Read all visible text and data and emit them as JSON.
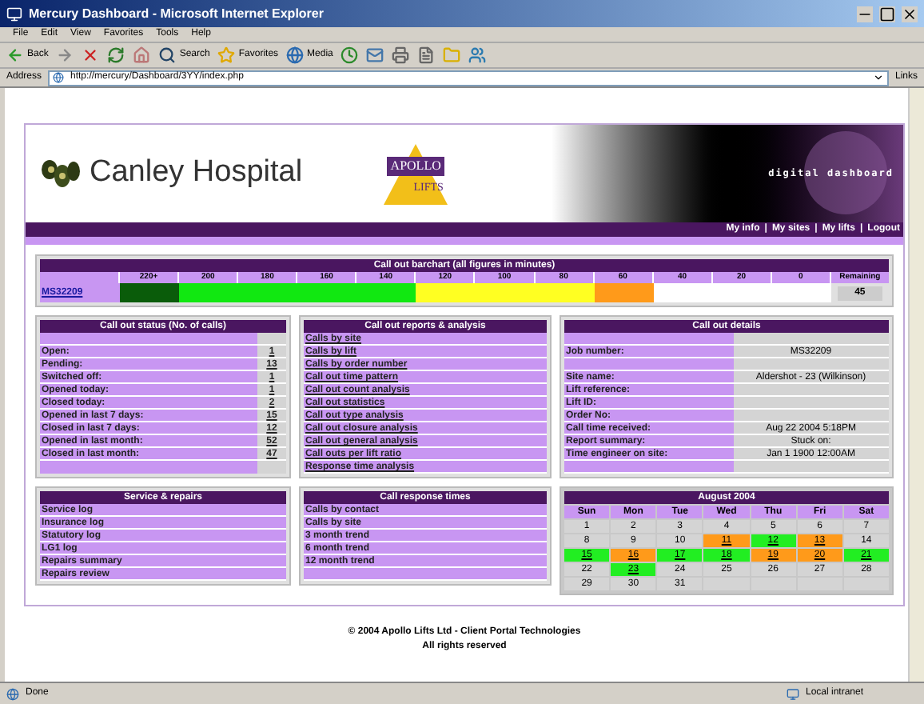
{
  "window": {
    "title": "Mercury Dashboard - Microsoft Internet Explorer"
  },
  "menu": [
    "File",
    "Edit",
    "View",
    "Favorites",
    "Tools",
    "Help"
  ],
  "toolbar": [
    {
      "kind": "back",
      "label": "Back"
    },
    {
      "kind": "forward"
    },
    {
      "kind": "stop"
    },
    {
      "kind": "refresh"
    },
    {
      "kind": "home"
    },
    {
      "kind": "search",
      "label": "Search"
    },
    {
      "kind": "favorites",
      "label": "Favorites"
    },
    {
      "kind": "media",
      "label": "Media"
    },
    {
      "kind": "history"
    },
    {
      "kind": "mail"
    },
    {
      "kind": "print"
    },
    {
      "kind": "edit"
    },
    {
      "kind": "folder"
    },
    {
      "kind": "messenger"
    }
  ],
  "address": {
    "label": "Address",
    "url": "http://mercury/Dashboard/3YY/index.php",
    "links": "Links"
  },
  "header": {
    "site": "Canley Hospital",
    "brand_top": "APOLLO",
    "brand_bottom": "LIFTS",
    "tagline": "digital dashboard",
    "nav": [
      "My info",
      "My sites",
      "My lifts",
      "Logout"
    ],
    "nav_separator": "|"
  },
  "barchart": {
    "title": "Call out barchart (all figures in minutes)",
    "columns": [
      "220+",
      "200",
      "180",
      "160",
      "140",
      "120",
      "100",
      "80",
      "60",
      "40",
      "20",
      "0"
    ],
    "remaining_label": "Remaining",
    "rows": [
      {
        "job": "MS32209",
        "cells": [
          {
            "color": "#0a5c0a"
          },
          {
            "color": "#11e811"
          },
          {
            "color": "#11e811"
          },
          {
            "color": "#11e811"
          },
          {
            "color": "#11e811"
          },
          {
            "color": "#ffff22"
          },
          {
            "color": "#ffff22"
          },
          {
            "color": "#ffff22"
          },
          {
            "color": "#ff9a1a"
          },
          {
            "color": "#ffffff"
          },
          {
            "color": "#ffffff"
          },
          {
            "color": "#ffffff"
          }
        ],
        "remaining": "45"
      }
    ]
  },
  "status": {
    "title": "Call out status (No. of calls)",
    "rows": [
      {
        "label": "Open:",
        "value": "1"
      },
      {
        "label": "Pending:",
        "value": "13"
      },
      {
        "label": "Switched off:",
        "value": "1"
      },
      {
        "label": "Opened today:",
        "value": "1"
      },
      {
        "label": "Closed today:",
        "value": "2"
      },
      {
        "label": "Opened in last 7 days:",
        "value": "15"
      },
      {
        "label": "Closed in last 7 days:",
        "value": "12"
      },
      {
        "label": "Opened in last month:",
        "value": "52"
      },
      {
        "label": "Closed in last month:",
        "value": "47"
      }
    ]
  },
  "reports": {
    "title": "Call out reports & analysis",
    "links": [
      "Calls by site",
      "Calls by lift",
      "Calls by order number",
      "Call out time pattern",
      "Call out count analysis",
      "Call out statistics",
      "Call out type analysis",
      "Call out closure analysis",
      "Call out general analysis",
      "Call outs per lift ratio",
      "Response time analysis"
    ]
  },
  "details": {
    "title": "Call out details",
    "rows": [
      {
        "kind": "spacer"
      },
      {
        "kind": "field",
        "label": "Job number:",
        "value": "MS32209"
      },
      {
        "kind": "spacer"
      },
      {
        "kind": "field",
        "label": "Site name:",
        "value": "Aldershot - 23 (Wilkinson)"
      },
      {
        "kind": "field",
        "label": "Lift reference:"
      },
      {
        "kind": "field",
        "label": "Lift ID:"
      },
      {
        "kind": "field",
        "label": "Order No:"
      },
      {
        "kind": "field",
        "label": "Call time received:",
        "value": "Aug 22 2004 5:18PM"
      },
      {
        "kind": "field",
        "label": "Report summary:",
        "value": "Stuck on:"
      },
      {
        "kind": "field",
        "label": "Time engineer on site:",
        "value": "Jan 1 1900 12:00AM"
      },
      {
        "kind": "spacer"
      }
    ]
  },
  "service": {
    "title": "Service & repairs",
    "links": [
      "Service log",
      "Insurance log",
      "Statutory log",
      "LG1 log",
      "Repairs summary",
      "Repairs review"
    ]
  },
  "response": {
    "title": "Call response times",
    "links": [
      "Calls by contact",
      "Calls by site",
      "3 month trend",
      "6 month trend",
      "12 month trend"
    ]
  },
  "calendar": {
    "title": "August 2004",
    "weekdays": [
      "Sun",
      "Mon",
      "Tue",
      "Wed",
      "Thu",
      "Fri",
      "Sat"
    ],
    "weeks": [
      [
        {
          "day": "1"
        },
        {
          "day": "2"
        },
        {
          "day": "3"
        },
        {
          "day": "4"
        },
        {
          "day": "5"
        },
        {
          "day": "6"
        },
        {
          "day": "7"
        }
      ],
      [
        {
          "day": "8"
        },
        {
          "day": "9"
        },
        {
          "day": "10"
        },
        {
          "day": "11",
          "color": "#ff9a1a"
        },
        {
          "day": "12",
          "color": "#22ee22"
        },
        {
          "day": "13",
          "color": "#ff9a1a"
        },
        {
          "day": "14"
        }
      ],
      [
        {
          "day": "15",
          "color": "#22ee22"
        },
        {
          "day": "16",
          "color": "#ff9a1a"
        },
        {
          "day": "17",
          "color": "#22ee22"
        },
        {
          "day": "18",
          "color": "#22ee22"
        },
        {
          "day": "19",
          "color": "#ff9a1a"
        },
        {
          "day": "20",
          "color": "#ff9a1a"
        },
        {
          "day": "21",
          "color": "#22ee22"
        }
      ],
      [
        {
          "day": "22"
        },
        {
          "day": "23",
          "color": "#22ee22"
        },
        {
          "day": "24"
        },
        {
          "day": "25"
        },
        {
          "day": "26"
        },
        {
          "day": "27"
        },
        {
          "day": "28"
        }
      ],
      [
        {
          "day": "29"
        },
        {
          "day": "30"
        },
        {
          "day": "31"
        }
      ]
    ]
  },
  "footer": [
    "© 2004 Apollo Lifts Ltd - Client Portal Technologies",
    "All rights reserved"
  ],
  "status_bar": {
    "text": "Done",
    "zone": "Local intranet"
  }
}
